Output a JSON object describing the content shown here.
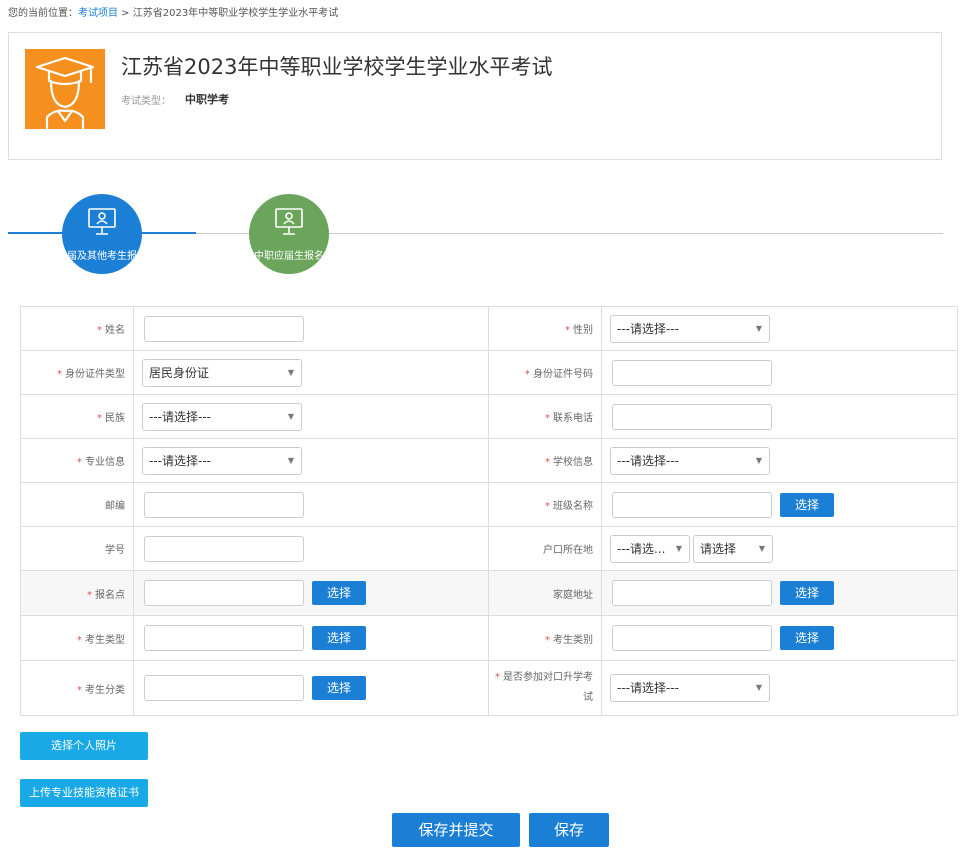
{
  "breadcrumb": {
    "prefix": "您的当前位置：",
    "link": "考试项目",
    "sep": " > ",
    "current": "江苏省2023年中等职业学校学生学业水平考试"
  },
  "exam": {
    "title": "江苏省2023年中等职业学校学生学业水平考试",
    "type_label": "考试类型：",
    "type_value": "中职学考",
    "logo_icon": "graduate-cap-icon",
    "logo_color": "#f5901e"
  },
  "steps": [
    {
      "label": "往届及其他考生报名",
      "color": "#1c7fd6",
      "icon": "monitor-user-icon",
      "active": true
    },
    {
      "label": "中职应届生报名",
      "color": "#6aa55b",
      "icon": "monitor-user-icon",
      "active": false
    }
  ],
  "form": {
    "placeholder_select": "---请选择---",
    "placeholder_select_short": "---请选...",
    "placeholder_select_plain": "请选择",
    "pick_label": "选择",
    "fields": {
      "name": "姓名",
      "gender": "性别",
      "id_type": "身份证件类型",
      "id_type_value": "居民身份证",
      "id_number": "身份证件号码",
      "ethnicity": "民族",
      "phone": "联系电话",
      "major": "专业信息",
      "school": "学校信息",
      "postcode": "邮编",
      "class_name": "班级名称",
      "student_no": "学号",
      "hukou": "户口所在地",
      "test_site": "报名点",
      "home_address": "家庭地址",
      "candidate_type": "考生类型",
      "candidate_category": "考生类别",
      "candidate_class": "考生分类",
      "join_exam_line1": "是否参加对口升学考",
      "join_exam_line2": "试"
    }
  },
  "buttons": {
    "select_photo": "选择个人照片",
    "upload_cert": "上传专业技能资格证书",
    "save_submit": "保存并提交",
    "save": "保存"
  },
  "colors": {
    "primary": "#1c7fd6",
    "cyan": "#19a9e6",
    "required": "#d9534f"
  }
}
